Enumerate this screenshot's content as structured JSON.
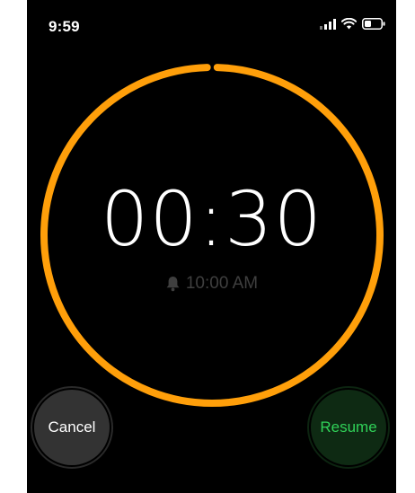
{
  "status_bar": {
    "time": "9:59",
    "icons": [
      "cellular-signal-icon",
      "wifi-icon",
      "battery-icon"
    ]
  },
  "timer": {
    "remaining": "00:30",
    "alarm_time": "10:00 AM",
    "alarm_icon": "bell-icon",
    "progress_fraction": 0.99
  },
  "buttons": {
    "cancel_label": "Cancel",
    "resume_label": "Resume"
  },
  "colors": {
    "ring": "#ff9f0a",
    "resume_text": "#30d158"
  }
}
